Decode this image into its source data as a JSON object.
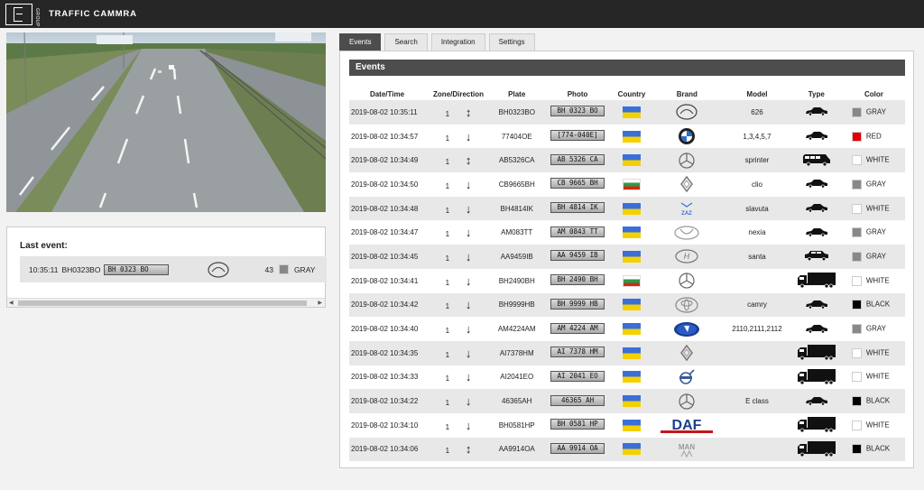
{
  "app": {
    "title": "TRAFFIC CAMMRA",
    "logo_sub": "GROUP"
  },
  "last_event": {
    "title": "Last event:",
    "time": "10:35:11",
    "plate": "BH0323BO",
    "plate_image_text": "BH 0323 BO",
    "brand_icon": "mazda-logo",
    "speed": "43",
    "color_name": "GRAY",
    "color_hex": "#888888"
  },
  "tabs": [
    {
      "label": "Events",
      "active": true
    },
    {
      "label": "Search",
      "active": false
    },
    {
      "label": "Integration",
      "active": false
    },
    {
      "label": "Settings",
      "active": false
    }
  ],
  "events": {
    "title": "Events",
    "columns": [
      "Date/Time",
      "Zone/Direction",
      "Plate",
      "Photo",
      "Country",
      "Brand",
      "Model",
      "Type",
      "Color"
    ],
    "rows": [
      {
        "datetime": "2019-08-02 10:35:11",
        "zone": "1",
        "direction": "both",
        "plate": "BH0323BO",
        "photo": "BH 0323 BO",
        "country": "ua",
        "brand": "mazda",
        "model": "626",
        "type": "car",
        "color": "GRAY",
        "color_hex": "#888888"
      },
      {
        "datetime": "2019-08-02 10:34:57",
        "zone": "1",
        "direction": "down",
        "plate": "77404OE",
        "photo": "[774-040E]",
        "country": "ua",
        "brand": "bmw",
        "model": "1,3,4,5,7",
        "type": "car",
        "color": "RED",
        "color_hex": "#e00000"
      },
      {
        "datetime": "2019-08-02 10:34:49",
        "zone": "1",
        "direction": "both",
        "plate": "AB5326CA",
        "photo": "AB 5326 CA",
        "country": "ua",
        "brand": "mercedes",
        "model": "sprinter",
        "type": "van",
        "color": "WHITE",
        "color_hex": "#ffffff"
      },
      {
        "datetime": "2019-08-02 10:34:50",
        "zone": "1",
        "direction": "down",
        "plate": "CB9665BH",
        "photo": "CB 9665 BH",
        "country": "bg",
        "brand": "renault",
        "model": "clio",
        "type": "car",
        "color": "GRAY",
        "color_hex": "#888888"
      },
      {
        "datetime": "2019-08-02 10:34:48",
        "zone": "1",
        "direction": "down",
        "plate": "BH4814IK",
        "photo": "BH 4814 IK",
        "country": "ua",
        "brand": "zaz",
        "model": "slavuta",
        "type": "car",
        "color": "WHITE",
        "color_hex": "#ffffff"
      },
      {
        "datetime": "2019-08-02 10:34:47",
        "zone": "1",
        "direction": "down",
        "plate": "AM083TT",
        "photo": "AM 0843 TT",
        "country": "ua",
        "brand": "daewoo",
        "model": "nexia",
        "type": "car",
        "color": "GRAY",
        "color_hex": "#888888"
      },
      {
        "datetime": "2019-08-02 10:34:45",
        "zone": "1",
        "direction": "down",
        "plate": "AA9459IB",
        "photo": "AA 9459 IB",
        "country": "ua",
        "brand": "hyundai",
        "model": "santa",
        "type": "suv",
        "color": "GRAY",
        "color_hex": "#888888"
      },
      {
        "datetime": "2019-08-02 10:34:41",
        "zone": "1",
        "direction": "down",
        "plate": "BH2490BH",
        "photo": "BH 2490 BH",
        "country": "bg",
        "brand": "mercedes",
        "model": "",
        "type": "truck",
        "color": "WHITE",
        "color_hex": "#ffffff"
      },
      {
        "datetime": "2019-08-02 10:34:42",
        "zone": "1",
        "direction": "down",
        "plate": "BH9999HB",
        "photo": "BH 9999 HB",
        "country": "ua",
        "brand": "toyota",
        "model": "camry",
        "type": "car",
        "color": "BLACK",
        "color_hex": "#000000"
      },
      {
        "datetime": "2019-08-02 10:34:40",
        "zone": "1",
        "direction": "down",
        "plate": "AM4224AM",
        "photo": "AM 4224 AM",
        "country": "ua",
        "brand": "lada",
        "model": "2110,2111,2112",
        "type": "car",
        "color": "GRAY",
        "color_hex": "#888888"
      },
      {
        "datetime": "2019-08-02 10:34:35",
        "zone": "1",
        "direction": "down",
        "plate": "AI7378HM",
        "photo": "AI 7378 HM",
        "country": "ua",
        "brand": "renault",
        "model": "",
        "type": "truck",
        "color": "WHITE",
        "color_hex": "#ffffff"
      },
      {
        "datetime": "2019-08-02 10:34:33",
        "zone": "1",
        "direction": "down",
        "plate": "AI2041EO",
        "photo": "AI 2041 EO",
        "country": "ua",
        "brand": "volvo",
        "model": "",
        "type": "truck",
        "color": "WHITE",
        "color_hex": "#ffffff"
      },
      {
        "datetime": "2019-08-02 10:34:22",
        "zone": "1",
        "direction": "down",
        "plate": "46365AH",
        "photo": "46365 AH",
        "country": "ua",
        "brand": "mercedes",
        "model": "E class",
        "type": "car",
        "color": "BLACK",
        "color_hex": "#000000"
      },
      {
        "datetime": "2019-08-02 10:34:10",
        "zone": "1",
        "direction": "down",
        "plate": "BH0581HP",
        "photo": "BH 0581 HP",
        "country": "ua",
        "brand": "daf",
        "model": "",
        "type": "truck",
        "color": "WHITE",
        "color_hex": "#ffffff"
      },
      {
        "datetime": "2019-08-02 10:34:06",
        "zone": "1",
        "direction": "both",
        "plate": "AA9914OA",
        "photo": "AA 9914 OA",
        "country": "ua",
        "brand": "man",
        "model": "",
        "type": "truck",
        "color": "BLACK",
        "color_hex": "#000000"
      }
    ]
  },
  "colors": {
    "topbar": "#262626",
    "tab_active": "#4d4d4d",
    "row_alt": "#e8e8e8"
  }
}
